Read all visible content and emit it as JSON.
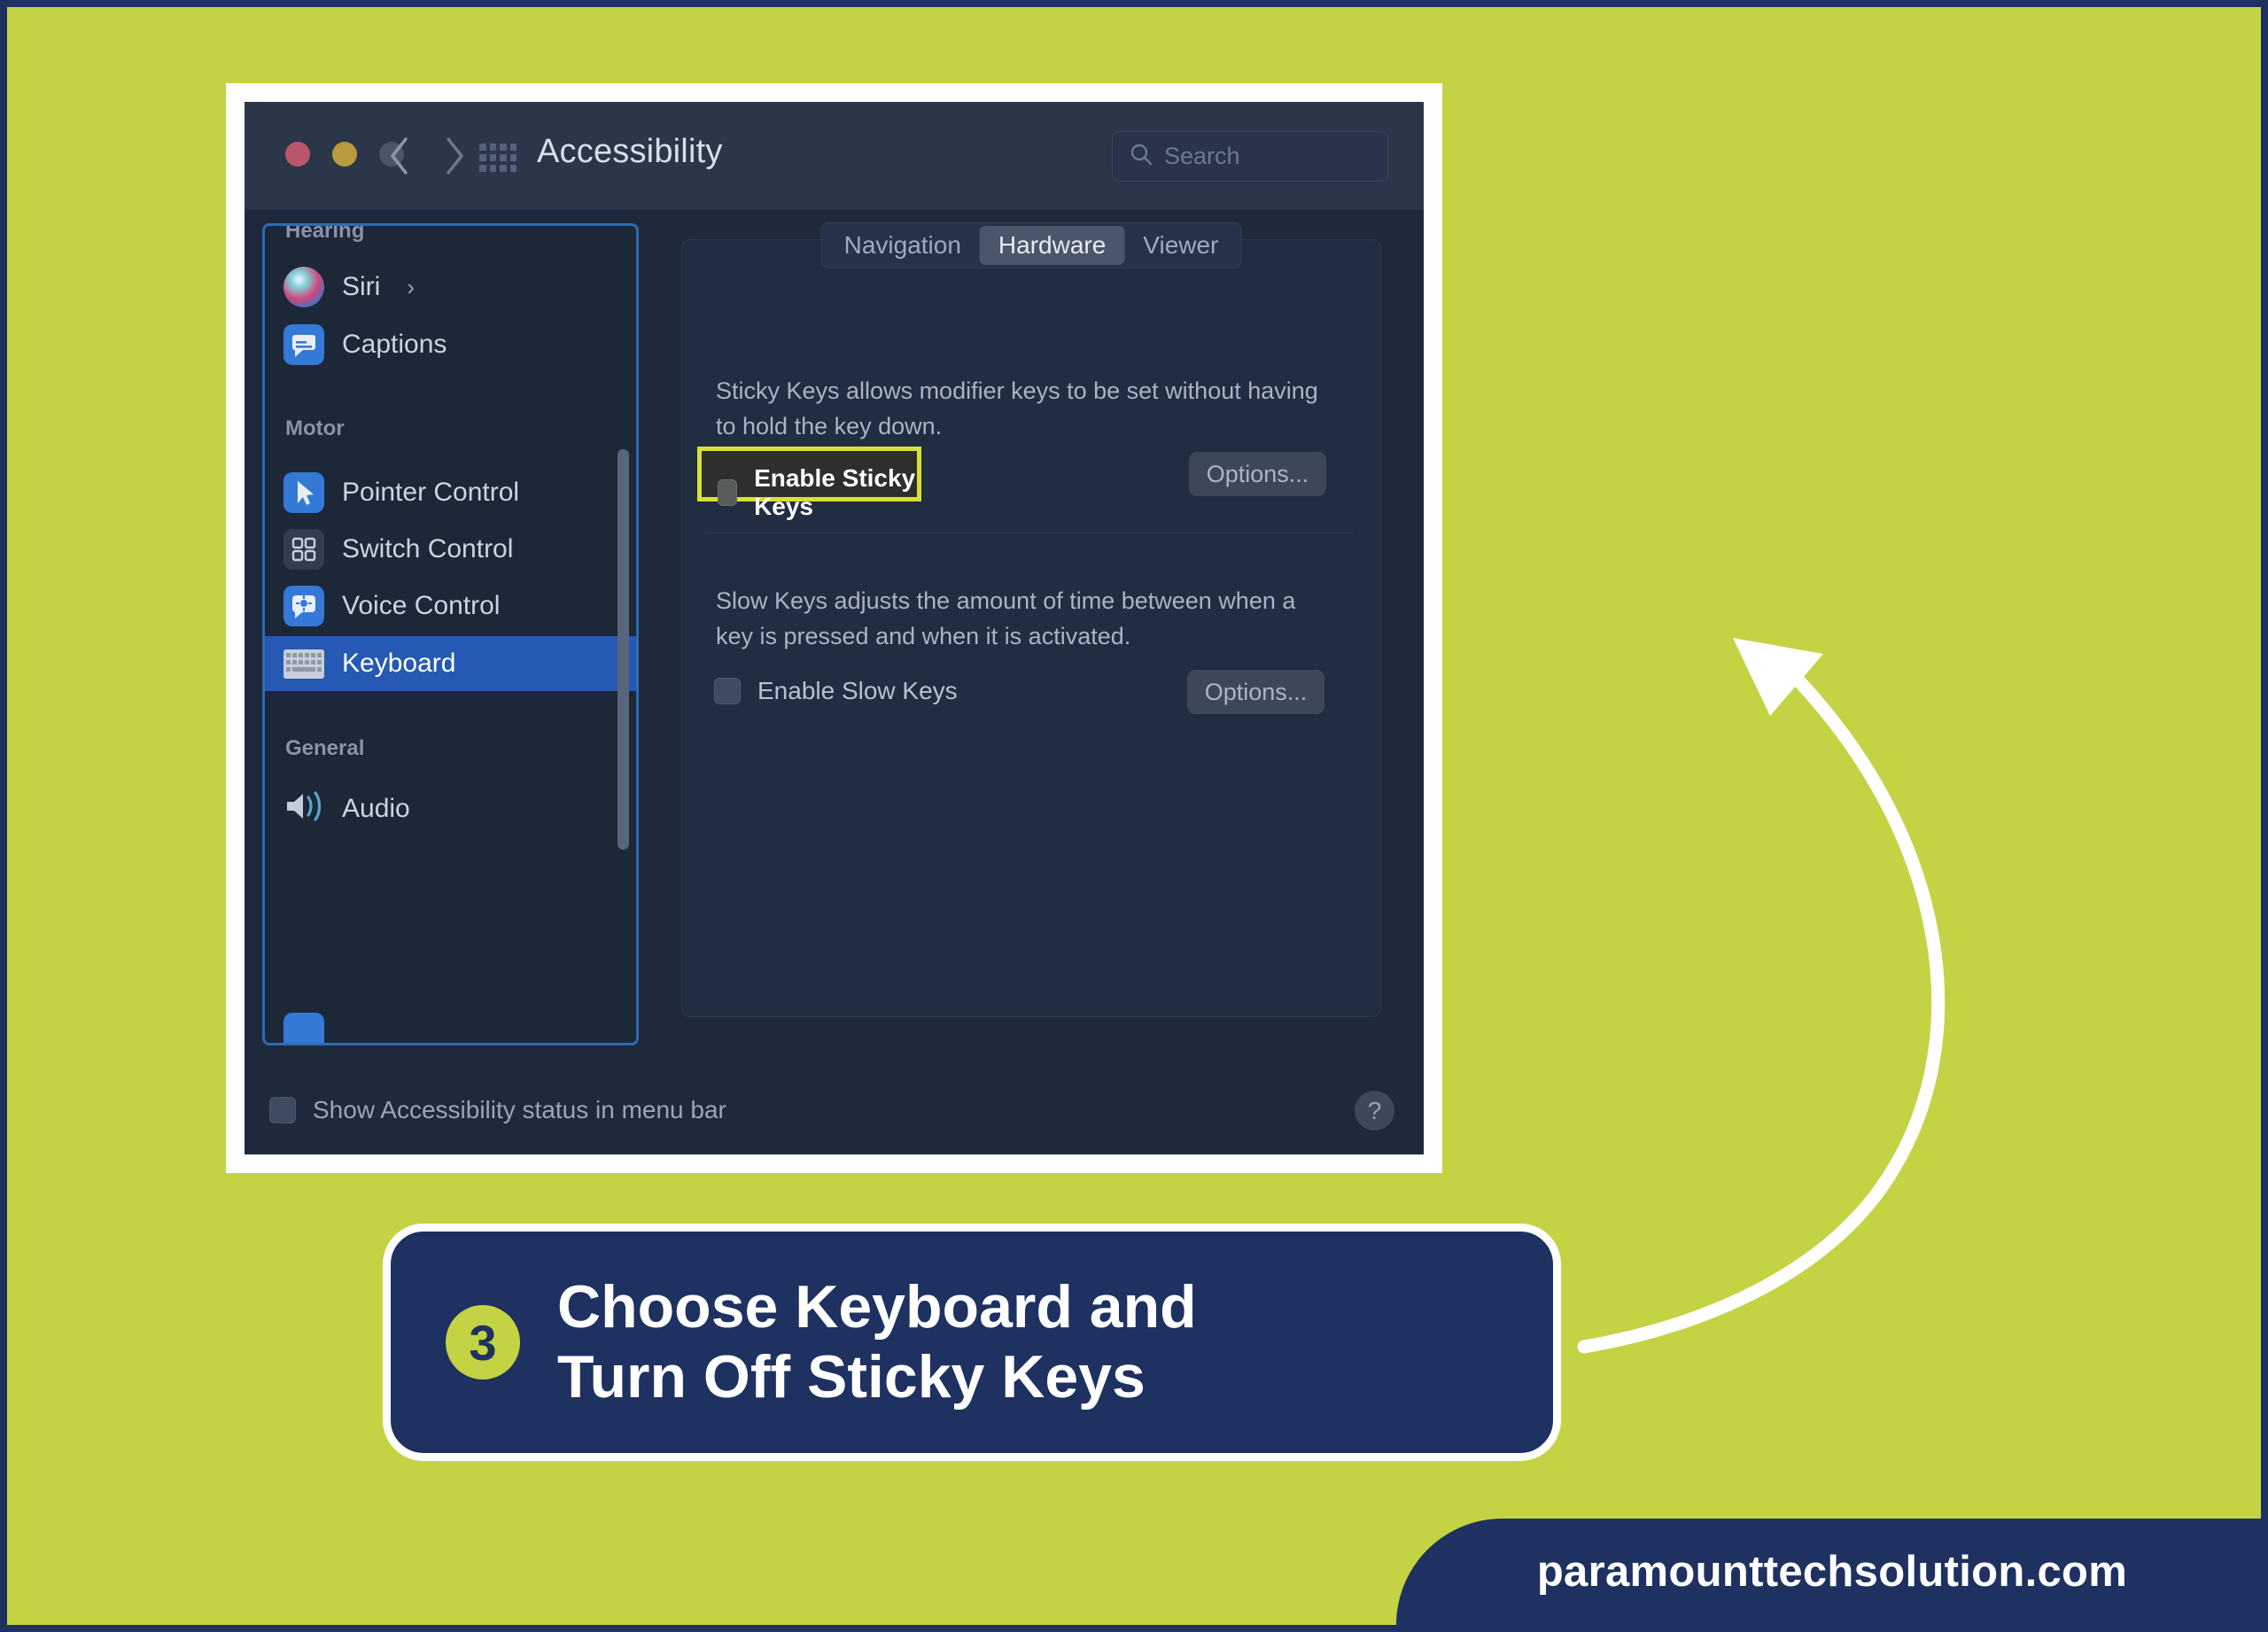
{
  "theme": {
    "accent_green": "#c3d344",
    "navy": "#1e3160",
    "highlight_yellow": "#d7e034",
    "selection_blue": "#2559b3",
    "focus_ring_blue": "#2f6ab4",
    "window_bg": "#1e293b"
  },
  "window": {
    "title": "Accessibility",
    "traffic_lights": [
      "close-button",
      "minimize-button",
      "zoom-button"
    ],
    "back_icon": "chevron-left-icon",
    "forward_icon": "chevron-right-icon",
    "grid_icon": "grid-view-icon",
    "search": {
      "icon": "search-icon",
      "placeholder": "Search",
      "value": ""
    }
  },
  "sidebar": {
    "groups": [
      {
        "label": "Hearing",
        "items": [
          {
            "label": "Siri",
            "icon": "siri-icon",
            "chevron": "›",
            "selected": false
          },
          {
            "label": "Captions",
            "icon": "captions-icon",
            "selected": false
          }
        ]
      },
      {
        "label": "Motor",
        "items": [
          {
            "label": "Pointer Control",
            "icon": "pointer-control-icon",
            "selected": false
          },
          {
            "label": "Switch Control",
            "icon": "switch-control-icon",
            "selected": false
          },
          {
            "label": "Voice Control",
            "icon": "voice-control-icon",
            "selected": false
          },
          {
            "label": "Keyboard",
            "icon": "keyboard-icon",
            "selected": true
          }
        ]
      },
      {
        "label": "General",
        "items": [
          {
            "label": "Audio",
            "icon": "audio-icon",
            "selected": false
          }
        ]
      }
    ]
  },
  "main": {
    "tabs": [
      {
        "label": "Navigation",
        "active": false
      },
      {
        "label": "Hardware",
        "active": true
      },
      {
        "label": "Viewer",
        "active": false
      }
    ],
    "sticky_keys": {
      "description": "Sticky Keys allows modifier keys to be set without having to hold the key down.",
      "checkbox_label": "Enable Sticky Keys",
      "checked": false,
      "options_label": "Options...",
      "highlighted": true
    },
    "slow_keys": {
      "description": "Slow Keys adjusts the amount of time between when a key is pressed and when it is activated.",
      "checkbox_label": "Enable Slow Keys",
      "checked": false,
      "options_label": "Options..."
    }
  },
  "status_bar": {
    "checkbox_label": "Show Accessibility status in menu bar",
    "checked": false,
    "help_label": "?"
  },
  "caption": {
    "step_number": "3",
    "line1": "Choose Keyboard and",
    "line2": "Turn Off Sticky Keys"
  },
  "footer": {
    "url": "paramounttechsolution.com"
  },
  "annotation": {
    "arrow": "curved-arrow-pointing-to-window"
  }
}
